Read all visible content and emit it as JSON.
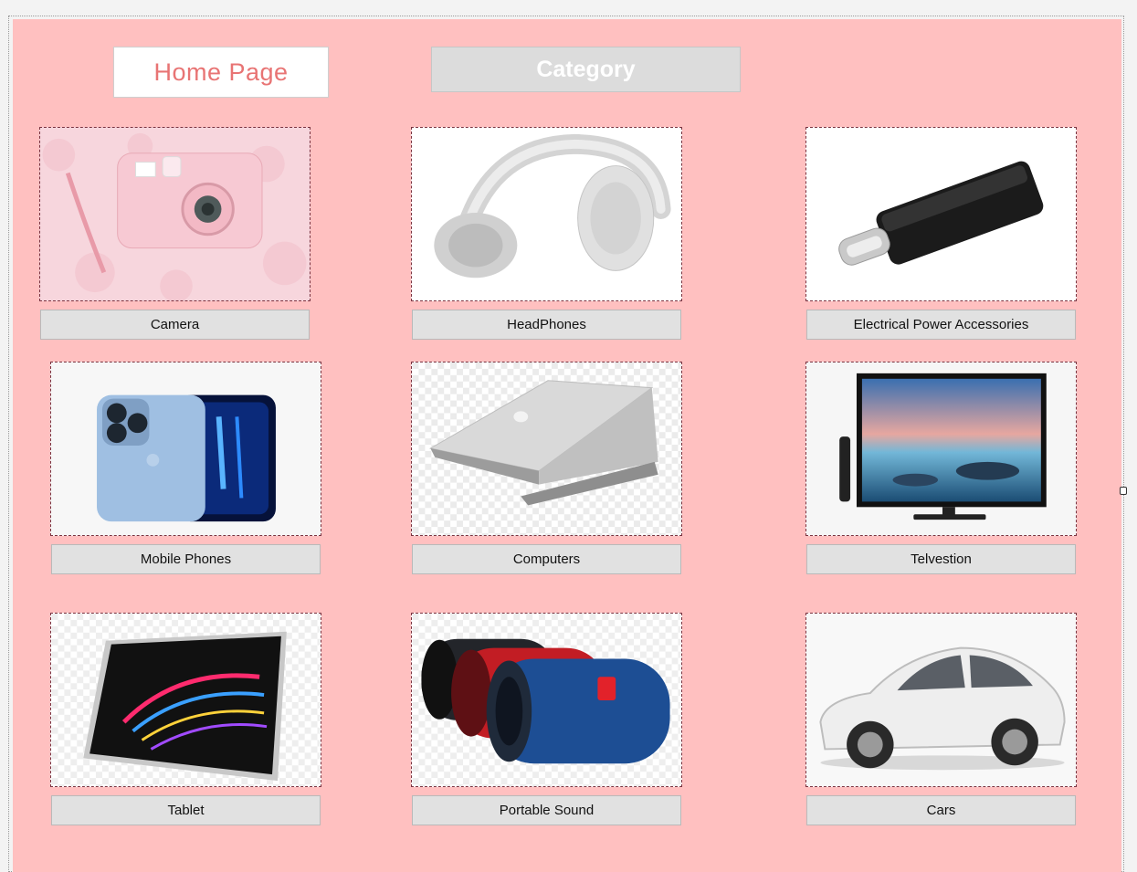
{
  "header": {
    "home_label": "Home Page",
    "category_label": "Category"
  },
  "categories": [
    {
      "label": "Camera",
      "icon": "camera-icon"
    },
    {
      "label": "HeadPhones",
      "icon": "headphones-icon"
    },
    {
      "label": "Electrical Power Accessories",
      "icon": "usb-adapter-icon"
    },
    {
      "label": "Mobile Phones",
      "icon": "smartphone-icon"
    },
    {
      "label": "Computers",
      "icon": "laptop-icon"
    },
    {
      "label": "Telvestion",
      "icon": "television-icon"
    },
    {
      "label": "Tablet",
      "icon": "tablet-icon"
    },
    {
      "label": "Portable Sound",
      "icon": "speaker-icon"
    },
    {
      "label": "Cars",
      "icon": "car-icon"
    }
  ],
  "colors": {
    "form_background": "#ffc0c0",
    "home_text": "#e87474",
    "button_gray": "#e1e1e1"
  }
}
